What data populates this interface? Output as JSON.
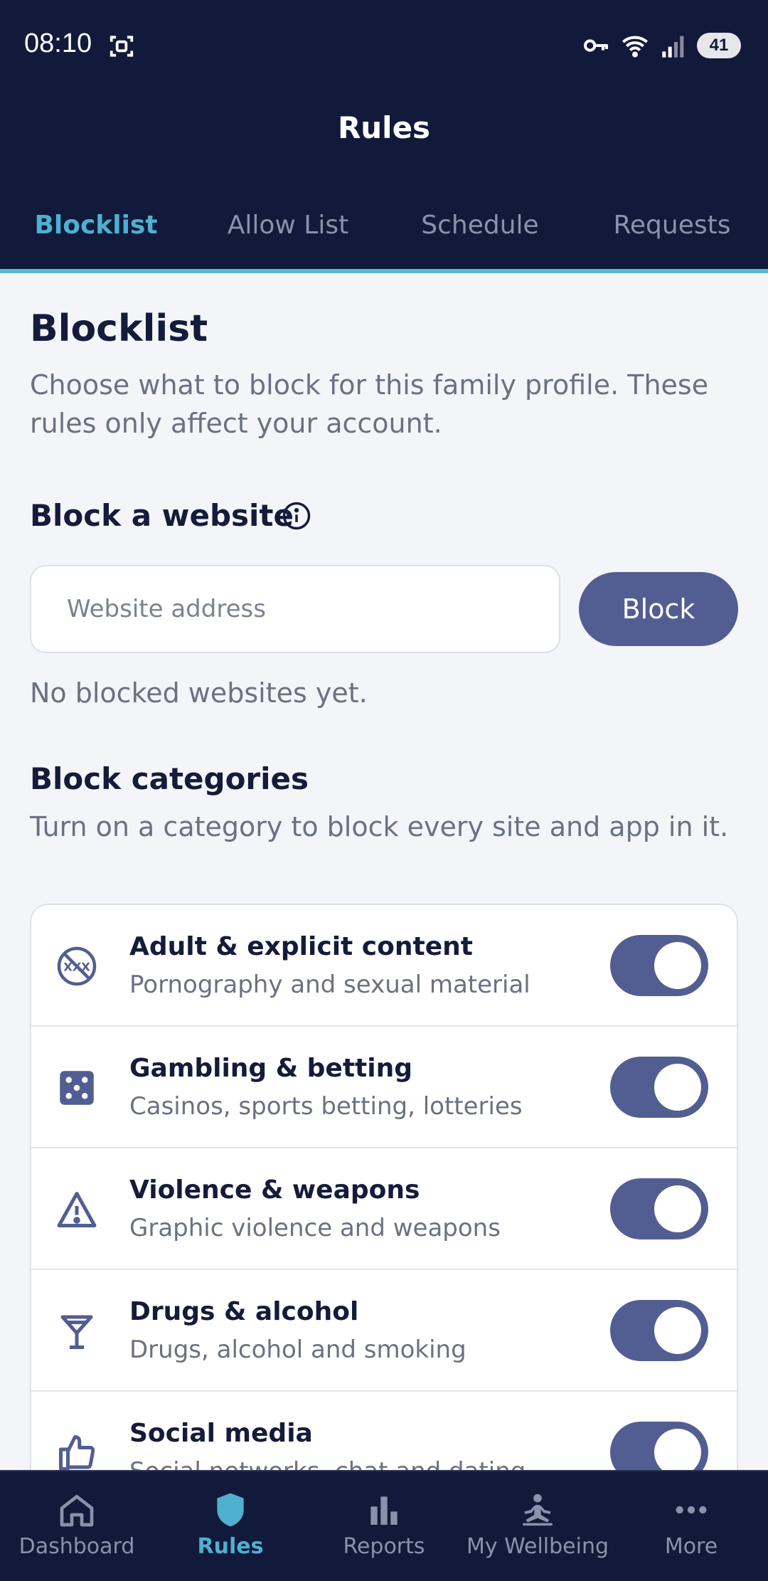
{
  "status_bar": {
    "time": "08:10",
    "battery": "41"
  },
  "header": {
    "title": "Rules"
  },
  "tabs": [
    {
      "label": "Blocklist",
      "active": true
    },
    {
      "label": "Allow List",
      "active": false
    },
    {
      "label": "Schedule",
      "active": false
    },
    {
      "label": "Requests",
      "active": false
    }
  ],
  "blocklist": {
    "title": "Blocklist",
    "description": "Choose what to block for this family profile. These rules only affect your account."
  },
  "block_website": {
    "title": "Block a website",
    "input_placeholder": "Website address",
    "button_label": "Block",
    "empty_text": "No blocked websites yet."
  },
  "block_categories": {
    "title": "Block categories",
    "description": "Turn on a category to block every site and app in it.",
    "items": [
      {
        "name": "Adult & explicit content",
        "sub": "Pornography and sexual material",
        "icon": "adult-content-icon",
        "enabled": true
      },
      {
        "name": "Gambling & betting",
        "sub": "Casinos, sports betting, lotteries",
        "icon": "dice-icon",
        "enabled": true
      },
      {
        "name": "Violence & weapons",
        "sub": "Graphic violence and weapons",
        "icon": "warning-icon",
        "enabled": true
      },
      {
        "name": "Drugs & alcohol",
        "sub": "Drugs, alcohol and smoking",
        "icon": "cocktail-icon",
        "enabled": true
      },
      {
        "name": "Social media",
        "sub": "Social networks, chat and dating",
        "icon": "thumbs-up-icon",
        "enabled": true
      }
    ]
  },
  "bottom_nav": [
    {
      "label": "Dashboard",
      "icon": "home-icon",
      "active": false
    },
    {
      "label": "Rules",
      "icon": "shield-icon",
      "active": true
    },
    {
      "label": "Reports",
      "icon": "bar-chart-icon",
      "active": false
    },
    {
      "label": "My Wellbeing",
      "icon": "meditation-icon",
      "active": false
    },
    {
      "label": "More",
      "icon": "more-icon",
      "active": false
    }
  ],
  "colors": {
    "header_bg": "#111a3b",
    "accent": "#4fb0cf",
    "primary": "#525e92",
    "page_bg": "#f3f5f8"
  }
}
